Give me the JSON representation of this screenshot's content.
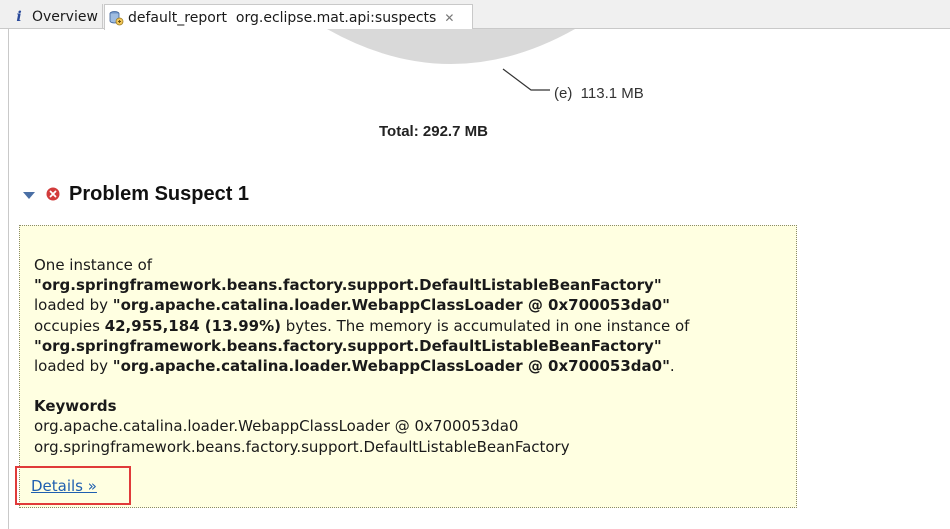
{
  "tabs": [
    {
      "label": "Overview",
      "active": false
    },
    {
      "label": "default_report  org.eclipse.mat.api:suspects",
      "active": true
    }
  ],
  "pie": {
    "slice_label": "(e)  113.1 MB",
    "slice_color": "#d9d9d9",
    "total": "Total: 292.7 MB"
  },
  "suspect": {
    "title": "Problem Suspect 1",
    "desc": {
      "l1": "One instance of",
      "class": "\"org.springframework.beans.factory.support.DefaultListableBeanFactory\"",
      "loaded_by": "loaded by ",
      "loader": "\"org.apache.catalina.loader.WebappClassLoader @ 0x700053da0\"",
      "occupies": "occupies ",
      "size": "42,955,184 (13.99%)",
      "mem_text": " bytes. The memory is accumulated in one instance of",
      "class2": "\"org.springframework.beans.factory.support.DefaultListableBeanFactory\"",
      "loaded_by2": "loaded by ",
      "loader2": "\"org.apache.catalina.loader.WebappClassLoader @ 0x700053da0\"",
      "period": "."
    },
    "keywords_label": "Keywords",
    "keywords": [
      "org.apache.catalina.loader.WebappClassLoader @ 0x700053da0",
      "org.springframework.beans.factory.support.DefaultListableBeanFactory"
    ],
    "details_label": "Details »"
  },
  "colors": {
    "box_background": "#ffffe1",
    "link": "#1f5fb0",
    "highlight_border": "#e03a3a",
    "error_icon": "#d23b3b"
  }
}
